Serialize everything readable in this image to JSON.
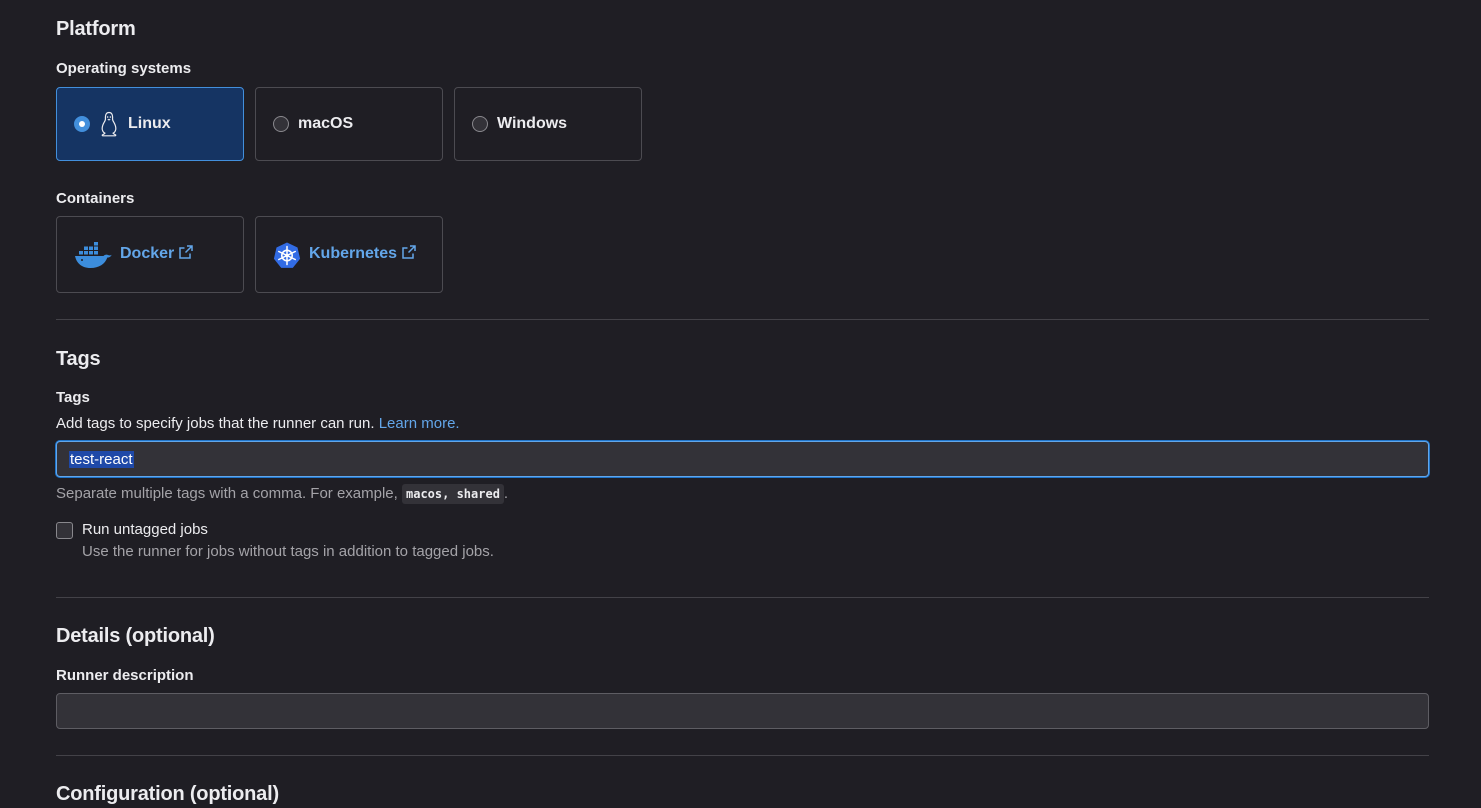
{
  "platform": {
    "title": "Platform",
    "os_label": "Operating systems",
    "os_options": [
      {
        "label": "Linux",
        "selected": true,
        "icon": "linux-tux-icon"
      },
      {
        "label": "macOS",
        "selected": false
      },
      {
        "label": "Windows",
        "selected": false
      }
    ],
    "containers_label": "Containers",
    "containers": [
      {
        "label": "Docker",
        "icon": "docker-icon"
      },
      {
        "label": "Kubernetes",
        "icon": "kubernetes-icon"
      }
    ]
  },
  "tags": {
    "section_title": "Tags",
    "field_label": "Tags",
    "help_text": "Add tags to specify jobs that the runner can run.",
    "learn_more": "Learn more.",
    "input_value": "test-react",
    "hint_prefix": "Separate multiple tags with a comma. For example,",
    "hint_code": "macos, shared",
    "hint_suffix": ".",
    "untagged_label": "Run untagged jobs",
    "untagged_help": "Use the runner for jobs without tags in addition to tagged jobs.",
    "untagged_checked": false
  },
  "details": {
    "title": "Details (optional)",
    "description_label": "Runner description",
    "description_value": ""
  },
  "configuration": {
    "title": "Configuration (optional)"
  },
  "colors": {
    "background": "#1f1e24",
    "accent": "#428fdc",
    "link": "#63a6e9",
    "selected_card": "#153463"
  }
}
